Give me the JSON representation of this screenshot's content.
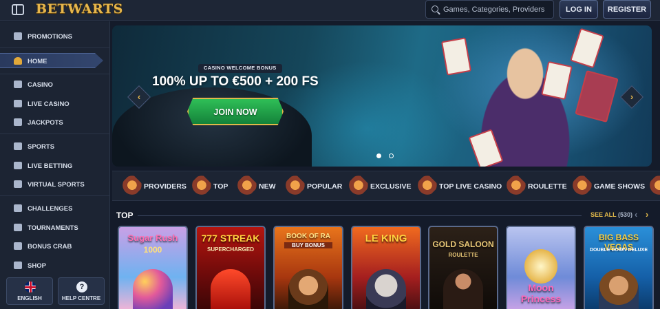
{
  "header": {
    "logo": "BETWARTS",
    "search_placeholder": "Games, Categories, Providers",
    "login_label": "LOG IN",
    "register_label": "REGISTER"
  },
  "sidebar": {
    "items": [
      {
        "label": "PROMOTIONS",
        "icon": "promotions-icon"
      },
      {
        "label": "HOME",
        "icon": "wizard-hat-icon",
        "active": true
      },
      {
        "label": "CASINO",
        "icon": "casino-icon"
      },
      {
        "label": "LIVE CASINO",
        "icon": "live-casino-icon"
      },
      {
        "label": "JACKPOTS",
        "icon": "jackpots-icon"
      },
      {
        "label": "SPORTS",
        "icon": "sports-icon"
      },
      {
        "label": "LIVE BETTING",
        "icon": "live-betting-icon"
      },
      {
        "label": "VIRTUAL SPORTS",
        "icon": "virtual-sports-icon"
      },
      {
        "label": "CHALLENGES",
        "icon": "challenges-icon"
      },
      {
        "label": "TOURNAMENTS",
        "icon": "tournaments-icon"
      },
      {
        "label": "BONUS CRAB",
        "icon": "bonus-crab-icon"
      },
      {
        "label": "SHOP",
        "icon": "shop-icon"
      }
    ],
    "language_label": "ENGLISH",
    "help_label": "HELP CENTRE"
  },
  "hero": {
    "badge": "CASINO WELCOME BONUS",
    "title": "100% UP TO €500 + 200 FS",
    "cta": "JOIN NOW",
    "active_slide": 1,
    "slides": 2
  },
  "categories": [
    {
      "label": "PROVIDERS",
      "icon": "providers-icon"
    },
    {
      "label": "TOP",
      "icon": "crown-icon"
    },
    {
      "label": "NEW",
      "icon": "lightning-icon"
    },
    {
      "label": "POPULAR",
      "icon": "popular-icon"
    },
    {
      "label": "EXCLUSIVE",
      "icon": "exclusive-icon"
    },
    {
      "label": "TOP LIVE CASINO",
      "icon": "live-casino-icon"
    },
    {
      "label": "ROULETTE",
      "icon": "roulette-icon"
    },
    {
      "label": "GAME SHOWS",
      "icon": "game-shows-icon"
    }
  ],
  "top_section": {
    "title": "TOP",
    "see_all": "SEE ALL",
    "count": "(530)"
  },
  "games": [
    {
      "name": "Sugar Rush",
      "sub": "1000"
    },
    {
      "name": "777 STREAK",
      "sub": "SUPERCHARGED"
    },
    {
      "name": "BOOK OF RA",
      "sub": "BUY BONUS"
    },
    {
      "name": "LE KING",
      "sub": ""
    },
    {
      "name": "GOLD SALOON",
      "sub": "ROULETTE"
    },
    {
      "name": "Moon Princess",
      "sub": ""
    },
    {
      "name": "BIG BASS VEGAS",
      "sub": "DOUBLE DOWN DELUXE"
    }
  ],
  "colors": {
    "accent_gold": "#e0b84a",
    "cta_green": "#2fbf57",
    "bg": "#141b2a"
  }
}
